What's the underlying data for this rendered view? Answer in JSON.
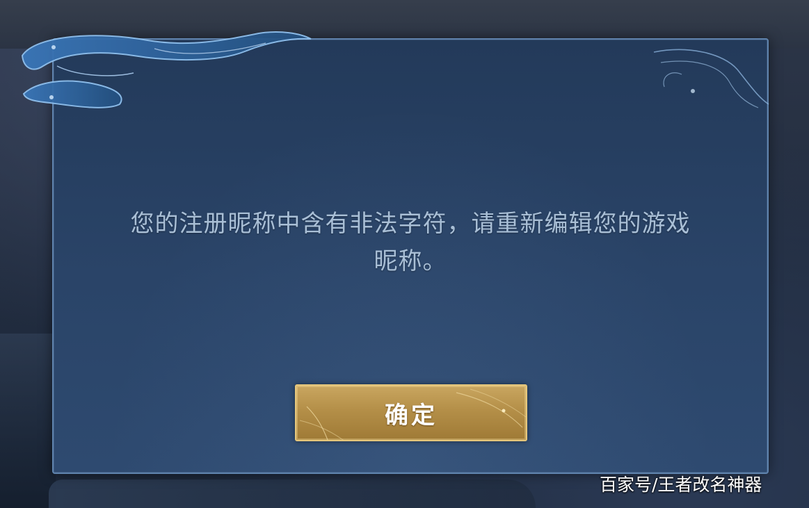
{
  "dialog": {
    "message_line1": "您的注册昵称中含有非法字符，请重新编辑您的游戏",
    "message_line2": "昵称。",
    "confirm_label": "确定"
  },
  "watermark": {
    "text": "百家号/王者改名神器"
  },
  "colors": {
    "dialog_background": "#2a4468",
    "dialog_border": "#5f83ad",
    "message_text": "#a9bfd6",
    "button_gold": "#b48f48",
    "button_border": "#e6c77c"
  },
  "icons": {
    "left_ornament": "cloud-swirl-ornament",
    "right_ornament": "wave-swirl-ornament"
  }
}
